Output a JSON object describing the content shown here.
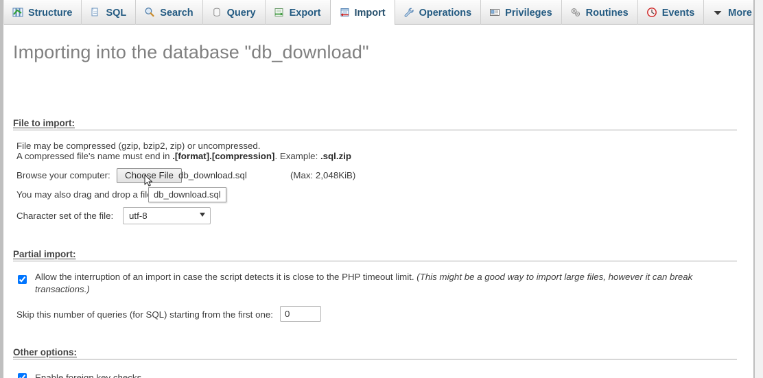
{
  "tabs": [
    {
      "label": "Structure",
      "icon": "structure-icon",
      "active": false
    },
    {
      "label": "SQL",
      "icon": "sql-icon",
      "active": false
    },
    {
      "label": "Search",
      "icon": "search-icon",
      "active": false
    },
    {
      "label": "Query",
      "icon": "query-icon",
      "active": false
    },
    {
      "label": "Export",
      "icon": "export-icon",
      "active": false
    },
    {
      "label": "Import",
      "icon": "import-icon",
      "active": true
    },
    {
      "label": "Operations",
      "icon": "operations-icon",
      "active": false
    },
    {
      "label": "Privileges",
      "icon": "privileges-icon",
      "active": false
    },
    {
      "label": "Routines",
      "icon": "routines-icon",
      "active": false
    },
    {
      "label": "Events",
      "icon": "events-icon",
      "active": false
    },
    {
      "label": "More",
      "icon": "chevron-down-icon",
      "active": false
    }
  ],
  "page": {
    "title": "Importing into the database \"db_download\""
  },
  "file_to_import": {
    "legend": "File to import:",
    "hint_line1": "File may be compressed (gzip, bzip2, zip) or uncompressed.",
    "hint_line2_pre": "A compressed file's name must end in ",
    "hint_line2_bold1": ".[format].[compression]",
    "hint_line2_mid": ". Example: ",
    "hint_line2_bold2": ".sql.zip",
    "browse_label": "Browse your computer:",
    "choose_file_button": "Choose File",
    "selected_filename": "db_download.sql",
    "max_size": "(Max: 2,048KiB)",
    "dragdrop_text": "You may also drag and drop a file on any page.",
    "charset_label": "Character set of the file:",
    "charset_value": "utf-8",
    "charset_options": [
      "utf-8"
    ],
    "tooltip_text": "db_download.sql"
  },
  "partial_import": {
    "legend": "Partial import:",
    "allow_interrupt_checked": true,
    "allow_interrupt_normal": "Allow the interruption of an import in case the script detects it is close to the PHP timeout limit. ",
    "allow_interrupt_italic": "(This might be a good way to import large files, however it can break transactions.)",
    "skip_label": "Skip this number of queries (for SQL) starting from the first one:",
    "skip_value": "0"
  },
  "other_options": {
    "legend": "Other options:",
    "foreign_key_label": "Enable foreign key checks",
    "foreign_key_checked": true
  },
  "colors": {
    "tab_text": "#235a81",
    "title_text": "#808080",
    "legend_text": "#444444",
    "body_text": "#3d3d3d",
    "rule": "#a9a9a9",
    "tabbar_border": "#c6c6c6"
  }
}
